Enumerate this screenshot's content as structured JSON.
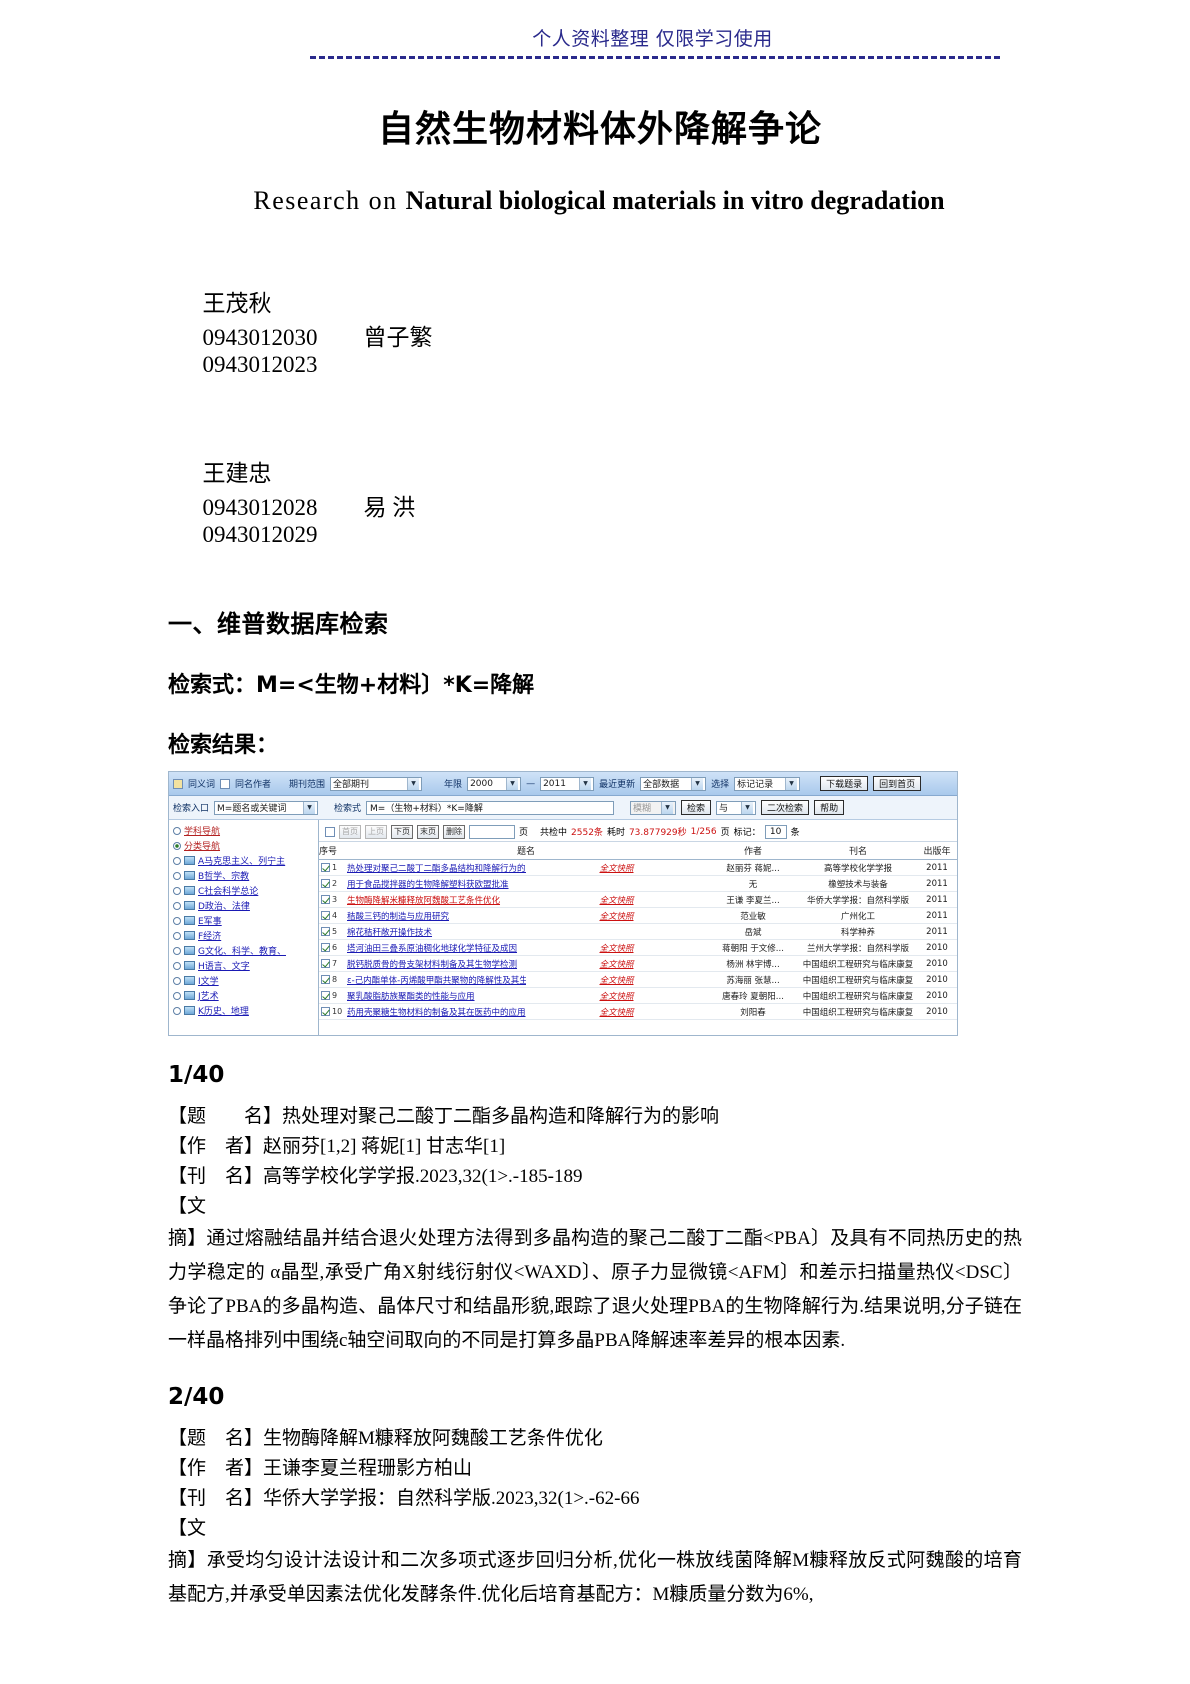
{
  "header": {
    "watermark": "个人资料整理  仅限学习使用"
  },
  "title": {
    "cn": "自然生物材料体外降解争论",
    "en_lead": "Research  on  ",
    "en_bold": "Natural biological materials in vitro degradation"
  },
  "authors": [
    {
      "left_name": "王茂秋",
      "left_id": "0943012030",
      "right_name": "曾子繁",
      "right_id": "0943012023"
    },
    {
      "left_name": "王建忠",
      "left_id": "0943012028",
      "right_name": "易 洪",
      "right_id": "0943012029"
    }
  ],
  "sections": {
    "heading_1": "一、维普数据库检索",
    "query_line": "检索式：M=<生物+材料〕*K=降解",
    "result_label": "检索结果："
  },
  "screenshot": {
    "toolbar_row1": {
      "synonym_label": "同义词",
      "same_author_label": "同名作者",
      "journal_scope_label": "期刊范围",
      "journal_scope_value": "全部期刊",
      "year_label": "年限",
      "year_from": "2000",
      "year_dash": "—",
      "year_to": "2011",
      "latest_update_label": "最近更新",
      "data_scope_value": "全部数据",
      "select_label": "选择",
      "marked_records_value": "标记记录",
      "download_button": "下载题录",
      "home_button": "回到首页"
    },
    "toolbar_row2": {
      "entry_label": "检索入口",
      "entry_value": "M=题名或关键词",
      "formula_label": "检索式",
      "formula_value": "M=（生物+材料）*K=降解",
      "fuzzy_value": "模糊",
      "search_button": "检索",
      "logic_value": "与",
      "second_search_button": "二次检索",
      "help_button": "帮助"
    },
    "sidebar": [
      {
        "label": "学科导航",
        "type": "radio",
        "selected": false,
        "red": true
      },
      {
        "label": "分类导航",
        "type": "radio",
        "selected": true,
        "red": true
      },
      {
        "label": "A马克思主义、列宁主",
        "type": "folder",
        "selected": false
      },
      {
        "label": "B哲学、宗教",
        "type": "folder",
        "selected": false
      },
      {
        "label": "C社会科学总论",
        "type": "folder",
        "selected": false
      },
      {
        "label": "D政治、法律",
        "type": "folder",
        "selected": false
      },
      {
        "label": "E军事",
        "type": "folder",
        "selected": false
      },
      {
        "label": "F经济",
        "type": "folder",
        "selected": false
      },
      {
        "label": "G文化、科学、教育、",
        "type": "folder",
        "selected": false
      },
      {
        "label": "H语言、文字",
        "type": "folder",
        "selected": false
      },
      {
        "label": "I文学",
        "type": "folder",
        "selected": false
      },
      {
        "label": "J艺术",
        "type": "folder",
        "selected": false
      },
      {
        "label": "K历史、地理",
        "type": "folder",
        "selected": false
      }
    ],
    "nav": {
      "first_page": "首页",
      "prev_page": "上页",
      "next_page": "下页",
      "last_page": "末页",
      "delete": "删除",
      "page_input_value": "",
      "page_unit": "页",
      "status_prefix": "共检中",
      "status_count": "2552条",
      "status_time_label": "耗时",
      "status_time": "73.877929秒",
      "status_pages": "1/256",
      "status_page_unit": "页",
      "mark_label": "标记：",
      "mark_count": "10",
      "mark_unit": "条"
    },
    "table": {
      "columns": [
        "序号",
        "题名",
        "作者",
        "刊名",
        "出版年"
      ],
      "rows": [
        {
          "no": "1",
          "title": "热处理对聚己二酸丁二酯多晶结构和降解行为的影响",
          "pdf": "全文快照",
          "author": "赵丽芬 蒋妮...",
          "journal": "高等学校化学学报",
          "year": "2011"
        },
        {
          "no": "2",
          "title": "用于食品搅拌器的生物降解塑料获欧盟批准",
          "pdf": "",
          "author": "无",
          "journal": "橡塑技术与装备",
          "year": "2011"
        },
        {
          "no": "3",
          "title": "生物酶降解米糠释放阿魏酸工艺条件优化",
          "pdf": "全文快照",
          "author": "王谦 李夏兰...",
          "journal": "华侨大学学报：自然科学版",
          "year": "2011"
        },
        {
          "no": "4",
          "title": "秸酸三钙的制造与应用研究",
          "pdf": "全文快照",
          "author": "范业敏",
          "journal": "广州化工",
          "year": "2011"
        },
        {
          "no": "5",
          "title": "棉花秸秆敞开操作技术",
          "pdf": "",
          "author": "岳斌",
          "journal": "科学种养",
          "year": "2011"
        },
        {
          "no": "6",
          "title": "塔河油田三叠系原油稠化地球化学特征及成因",
          "pdf": "全文快照",
          "author": "蒋朝阳 于文修...",
          "journal": "兰州大学学报：自然科学版",
          "year": "2010"
        },
        {
          "no": "7",
          "title": "脱钙脱质骨的骨支架材料制备及其生物学检测",
          "pdf": "全文快照",
          "author": "杨洲 林宇博...",
          "journal": "中国组织工程研究与临床康复",
          "year": "2010"
        },
        {
          "no": "8",
          "title": "ε-己内酯单体-丙烯酸甲酯共聚物的降解性及其生物相容性",
          "pdf": "全文快照",
          "author": "苏海丽 张慧...",
          "journal": "中国组织工程研究与临床康复",
          "year": "2010"
        },
        {
          "no": "9",
          "title": "聚乳酸脂肪族聚酯类的性能与应用",
          "pdf": "全文快照",
          "author": "唐春玲 夏朝阳...",
          "journal": "中国组织工程研究与临床康复",
          "year": "2010"
        },
        {
          "no": "10",
          "title": "药用壳聚糖生物材料的制备及其在医药中的应用",
          "pdf": "全文快照",
          "author": "刘阳春",
          "journal": "中国组织工程研究与临床康复",
          "year": "2010"
        }
      ]
    }
  },
  "records": [
    {
      "number": "1/40",
      "field_title": "【题　　名】热处理对聚己二酸丁二酯多晶构造和降解行为的影响",
      "field_author": "【作　者】赵丽芬[1,2] 蒋妮[1] 甘志华[1]",
      "field_journal": "【刊　名】高等学校化学学报.2023,32(1>.-185-189",
      "field_abstract_label": "【文",
      "abstract": "摘】通过熔融结晶并结合退火处理方法得到多晶构造的聚己二酸丁二酯<PBA〕及具有不同热历史的热力学稳定的 α晶型,承受广角X射线衍射仪<WAXD〕、原子力显微镜<AFM〕和差示扫描量热仪<DSC〕争论了PBA的多晶构造、晶体尺寸和结晶形貌,跟踪了退火处理PBA的生物降解行为.结果说明,分子链在一样晶格排列中围绕c轴空间取向的不同是打算多晶PBA降解速率差异的根本因素."
    },
    {
      "number": "2/40",
      "field_title": "【题　名】生物酶降解M糠释放阿魏酸工艺条件优化",
      "field_author": "【作　者】王谦李夏兰程珊影方柏山",
      "field_journal": "【刊　名】华侨大学学报：自然科学版.2023,32(1>.-62-66",
      "field_abstract_label": "【文",
      "abstract": "摘】承受均匀设计法设计和二次多项式逐步回归分析,优化一株放线菌降解M糠释放反式阿魏酸的培育基配方,并承受单因素法优化发酵条件.优化后培育基配方：M糠质量分数为6%,"
    }
  ]
}
